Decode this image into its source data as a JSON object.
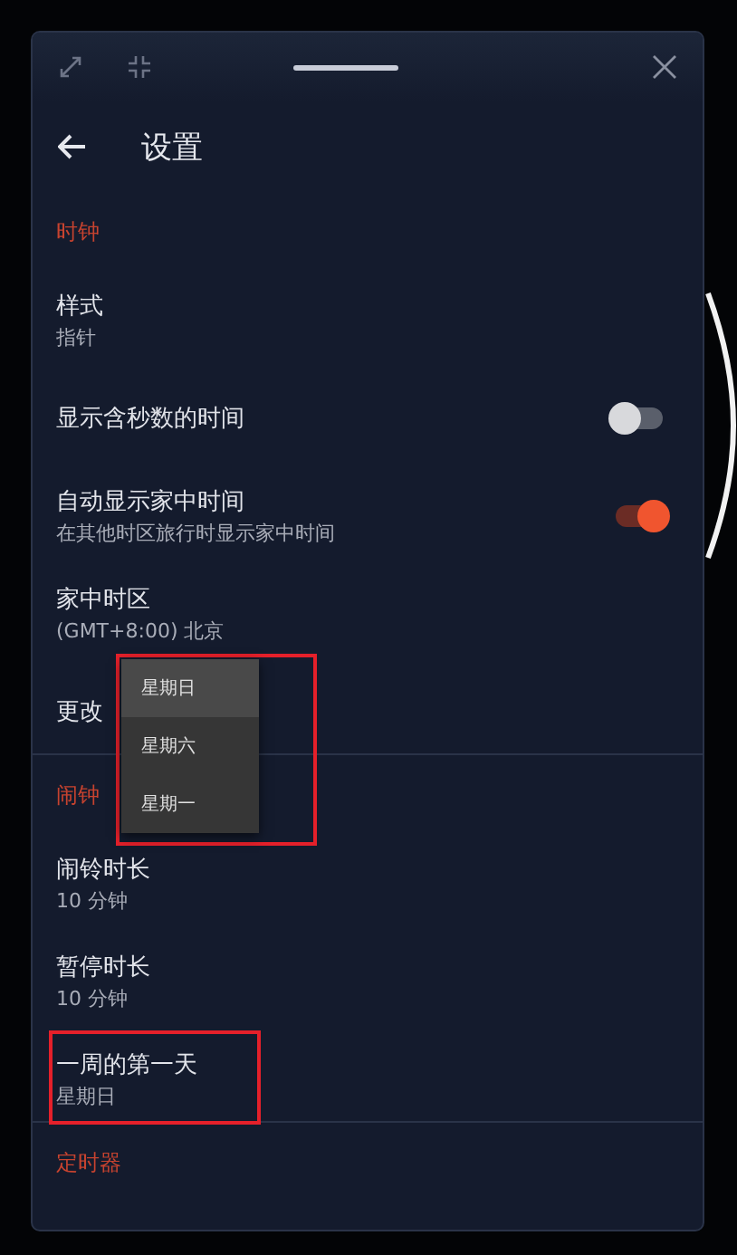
{
  "header": {
    "title": "设置"
  },
  "sections": [
    {
      "title": "时钟",
      "items": [
        {
          "kind": "text",
          "label": "样式",
          "value": "指针"
        },
        {
          "kind": "toggle",
          "label": "显示含秒数的时间",
          "on": false
        },
        {
          "kind": "toggle",
          "label": "自动显示家中时间",
          "value": "在其他时区旅行时显示家中时间",
          "on": true
        },
        {
          "kind": "text",
          "label": "家中时区",
          "value": "(GMT+8:00) 北京"
        },
        {
          "kind": "menu",
          "label": "更改",
          "highlighted": true,
          "options": [
            {
              "label": "星期日",
              "selected": true
            },
            {
              "label": "星期六",
              "selected": false
            },
            {
              "label": "星期一",
              "selected": false
            }
          ]
        }
      ]
    },
    {
      "title": "闹钟",
      "items": [
        {
          "kind": "text",
          "label": "闹铃时长",
          "value": "10 分钟"
        },
        {
          "kind": "text",
          "label": "暂停时长",
          "value": "10 分钟"
        },
        {
          "kind": "text",
          "label": "一周的第一天",
          "value": "星期日",
          "highlighted": true
        }
      ]
    },
    {
      "title": "定时器"
    }
  ]
}
